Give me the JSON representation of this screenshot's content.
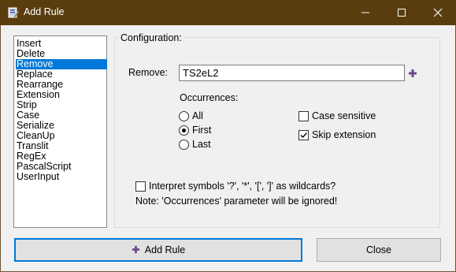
{
  "window": {
    "title": "Add Rule",
    "app_icon": "renamer-icon"
  },
  "title_controls": {
    "minimize": "minimize-icon",
    "maximize": "maximize-icon",
    "close": "close-icon"
  },
  "rules": {
    "items": [
      "Insert",
      "Delete",
      "Remove",
      "Replace",
      "Rearrange",
      "Extension",
      "Strip",
      "Case",
      "Serialize",
      "CleanUp",
      "Translit",
      "RegEx",
      "PascalScript",
      "UserInput"
    ],
    "selected": "Remove"
  },
  "config": {
    "group_label": "Configuration:",
    "remove_label": "Remove:",
    "remove_value": "TS2eL2",
    "add_icon": "plus-icon",
    "occurrences_label": "Occurrences:",
    "occurrences": [
      "All",
      "First",
      "Last"
    ],
    "occurrences_selected": "First",
    "case_sensitive_label": "Case sensitive",
    "case_sensitive_checked": false,
    "skip_extension_label": "Skip extension",
    "skip_extension_checked": true,
    "wildcards_label": "Interpret symbols '?', '*', '[', ']' as wildcards?",
    "wildcards_checked": false,
    "note": "Note: 'Occurrences' parameter will be ignored!"
  },
  "buttons": {
    "add_rule": "Add Rule",
    "close": "Close"
  },
  "colors": {
    "titlebar": "#5a3d0f",
    "selection": "#0078d7",
    "accent_icon": "#6a4a8c"
  }
}
